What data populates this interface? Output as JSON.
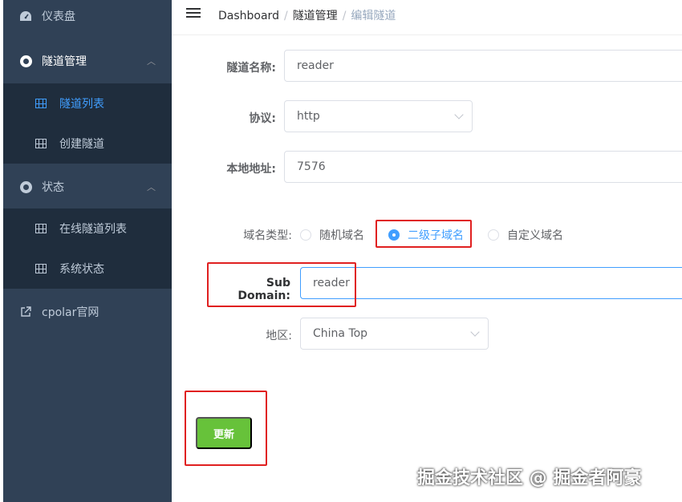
{
  "sidebar": {
    "dashboard": "仪表盘",
    "tunnel_mgmt": "隧道管理",
    "tunnel_list": "隧道列表",
    "create_tunnel": "创建隧道",
    "status": "状态",
    "online_tunnels": "在线隧道列表",
    "system_status": "系统状态",
    "cpolar_site": "cpolar官网"
  },
  "breadcrumb": {
    "home": "Dashboard",
    "section": "隧道管理",
    "current": "编辑隧道",
    "separator": "/"
  },
  "form": {
    "name_label": "隧道名称:",
    "name_value": "reader",
    "protocol_label": "协议:",
    "protocol_value": "http",
    "local_label": "本地地址:",
    "local_value": "7576",
    "domain_type_label": "域名类型:",
    "domain_types": [
      "随机域名",
      "二级子域名",
      "自定义域名"
    ],
    "domain_type_selected": "二级子域名",
    "subdomain_label": "Sub Domain:",
    "subdomain_value": "reader",
    "region_label": "地区:",
    "region_value": "China Top",
    "submit_label": "更新"
  },
  "watermark": "掘金技术社区 @ 掘金者阿豪",
  "colors": {
    "sidebar_bg": "#304156",
    "submenu_bg": "#1f2d3d",
    "active": "#409eff",
    "button": "#67c23a",
    "highlight": "#e02020"
  }
}
